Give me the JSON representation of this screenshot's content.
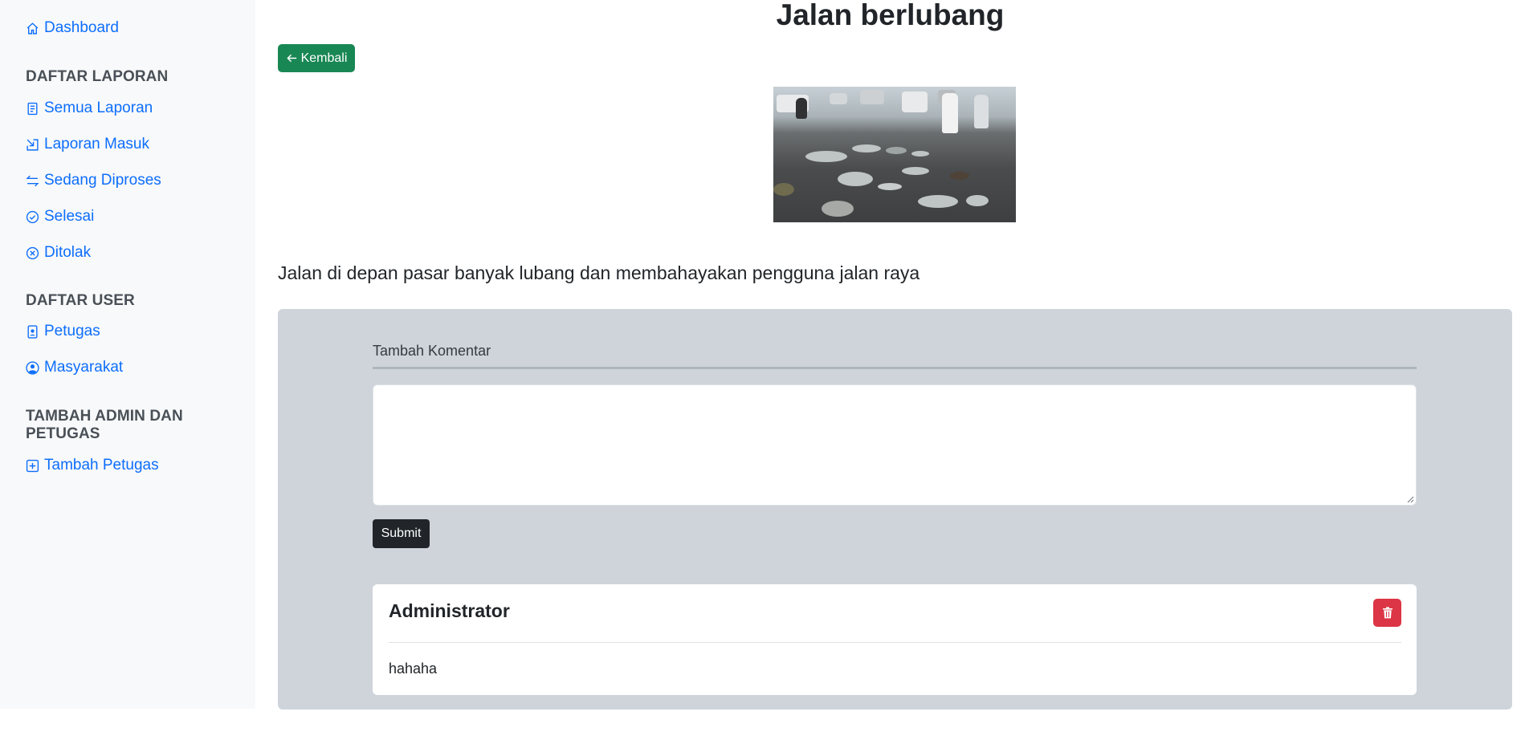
{
  "sidebar": {
    "dashboard": {
      "label": "Dashboard",
      "icon": "home-icon"
    },
    "sections": [
      {
        "heading": "DAFTAR LAPORAN",
        "items": [
          {
            "label": "Semua Laporan",
            "icon": "document-icon"
          },
          {
            "label": "Laporan Masuk",
            "icon": "inbox-arrow-icon"
          },
          {
            "label": "Sedang Diproses",
            "icon": "swap-arrows-icon"
          },
          {
            "label": "Selesai",
            "icon": "check-circle-icon"
          },
          {
            "label": "Ditolak",
            "icon": "x-circle-icon"
          }
        ]
      },
      {
        "heading": "DAFTAR USER",
        "items": [
          {
            "label": "Petugas",
            "icon": "badge-icon"
          },
          {
            "label": "Masyarakat",
            "icon": "user-circle-icon"
          }
        ]
      },
      {
        "heading": "TAMBAH ADMIN DAN PETUGAS",
        "items": [
          {
            "label": "Tambah Petugas",
            "icon": "plus-square-icon"
          }
        ]
      }
    ],
    "link_color": "#0d6efd"
  },
  "main": {
    "title": "Jalan berlubang",
    "back_button": {
      "label": "Kembali",
      "icon": "arrow-left-icon",
      "color": "#198754"
    },
    "description": "Jalan di depan pasar banyak lubang dan membahayakan pengguna jalan raya",
    "comment_form": {
      "label": "Tambah Komentar",
      "textarea_value": "",
      "submit_label": "Submit"
    },
    "comments": [
      {
        "author": "Administrator",
        "body": "hahaha",
        "delete_icon": "trash-icon",
        "delete_color": "#dc3545"
      }
    ]
  }
}
